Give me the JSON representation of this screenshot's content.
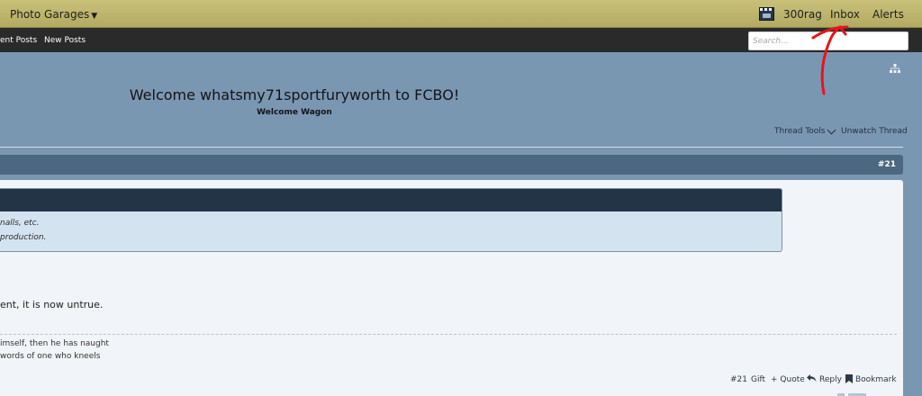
{
  "topbar": {
    "brand": "Photo Garages",
    "username": "300rag",
    "inbox": "Inbox",
    "alerts": "Alerts",
    "avatar_icon": "user-avatar-icon"
  },
  "nav": {
    "recent_posts": "ent Posts",
    "new_posts": "New Posts",
    "search_placeholder": "Search..."
  },
  "thread": {
    "title": "Welcome whatsmy71sportfuryworth to FCBO!",
    "forum": "Welcome Wagon",
    "tools": "Thread Tools",
    "unwatch": "Unwatch Thread"
  },
  "post": {
    "number": "#21",
    "notice_line1": "nalls, etc.",
    "notice_line2": "production.",
    "text": "ent, it is now untrue.",
    "signature_line1": "imself, then he has naught",
    "signature_line2": "words of one who kneels",
    "actions": {
      "number": "#21",
      "gift": "Gift",
      "quote": "+ Quote",
      "reply": "Reply",
      "bookmark": "Bookmark"
    }
  },
  "colors": {
    "topbar": "#c2b970",
    "navbar": "#2a2a2a",
    "header_bg": "#7a97b2",
    "post_header": "#4c6780",
    "annotation": "#e8141b"
  }
}
